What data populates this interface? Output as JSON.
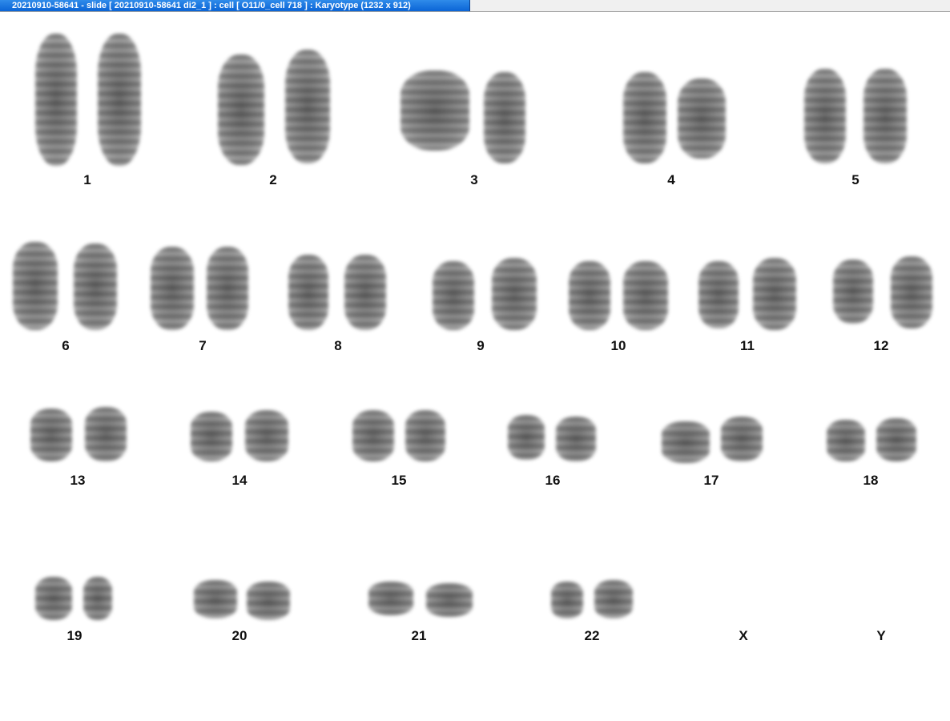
{
  "window": {
    "title": "20210910-58641 - slide [ 20210910-58641 di2_1 ] : cell [ O11/0_cell 718 ] : Karyotype  (1232 x 912)"
  },
  "karyotype": {
    "labels": {
      "c1": "1",
      "c2": "2",
      "c3": "3",
      "c4": "4",
      "c5": "5",
      "c6": "6",
      "c7": "7",
      "c8": "8",
      "c9": "9",
      "c10": "10",
      "c11": "11",
      "c12": "12",
      "c13": "13",
      "c14": "14",
      "c15": "15",
      "c16": "16",
      "c17": "17",
      "c18": "18",
      "c19": "19",
      "c20": "20",
      "c21": "21",
      "c22": "22",
      "cX": "X",
      "cY": "Y"
    }
  }
}
